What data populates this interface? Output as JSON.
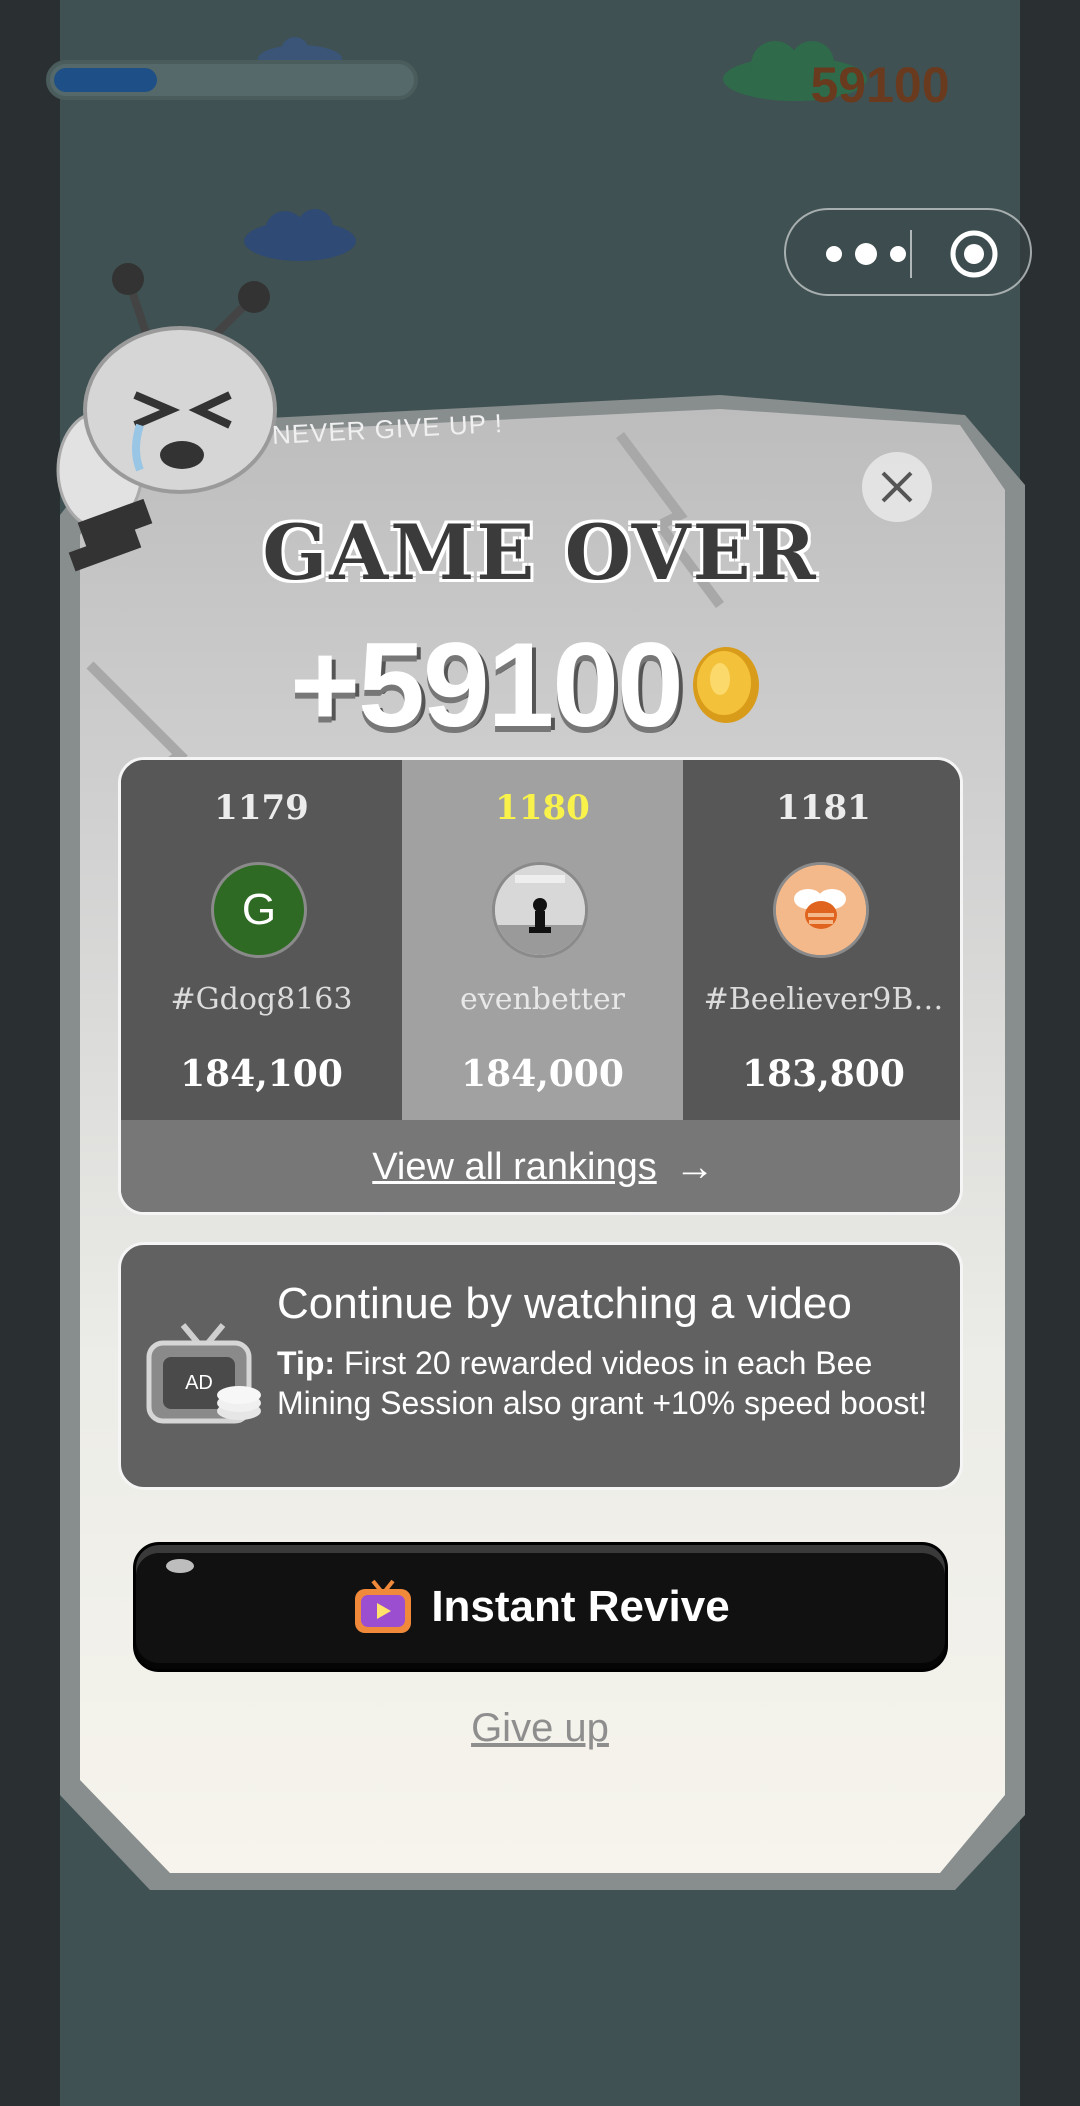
{
  "hud": {
    "progress_fraction": 0.29,
    "score": "59100"
  },
  "capsule": {
    "more_icon": "more-dots-icon",
    "record_icon": "target-circle-icon"
  },
  "modal": {
    "tagline": "NEVER GIVE UP !",
    "title": "GAME OVER",
    "reward": "+59100",
    "coin_icon": "gold-coin-icon",
    "close_icon": "close-icon"
  },
  "rankings": {
    "entries": [
      {
        "rank": "1179",
        "name": "#Gdog8163",
        "score": "184,100",
        "avatar_letter": "G",
        "avatar_color": "#2e6a23"
      },
      {
        "rank": "1180",
        "name": "evenbetter",
        "score": "184,000",
        "avatar_letter": "",
        "avatar_color": "#d0d0d0"
      },
      {
        "rank": "1181",
        "name": "#Beeliever9B…",
        "score": "183,800",
        "avatar_letter": "",
        "avatar_color": "#f4b98a"
      }
    ],
    "view_all": "View all rankings",
    "arrow": "→"
  },
  "video": {
    "title": "Continue by watching a video",
    "tip_label": "Tip:",
    "tip_text": " First 20 rewarded videos in each Bee Mining Session also grant +10% speed boost!",
    "tv_icon_text": "AD"
  },
  "actions": {
    "revive_label": "Instant Revive",
    "give_up_label": "Give up"
  },
  "colors": {
    "highlight_rank": "#f8f24a",
    "score_hud": "#6a3a1f"
  }
}
